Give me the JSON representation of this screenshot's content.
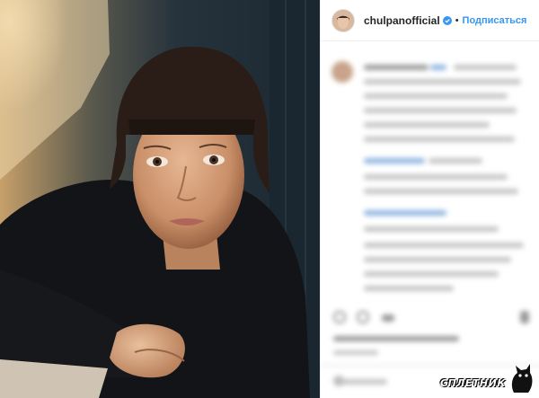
{
  "post": {
    "username": "chulpanofficial",
    "separator": "•",
    "follow_label": "Подписаться"
  },
  "icons": {
    "verified": "verified-badge-icon",
    "like": "heart-icon",
    "comment": "comment-icon",
    "share": "share-icon",
    "save": "bookmark-icon"
  },
  "colors": {
    "follow": "#3897f0",
    "verified": "#3897f0",
    "border": "#efefef"
  },
  "watermark": {
    "text": "СПЛЕТНИК"
  }
}
